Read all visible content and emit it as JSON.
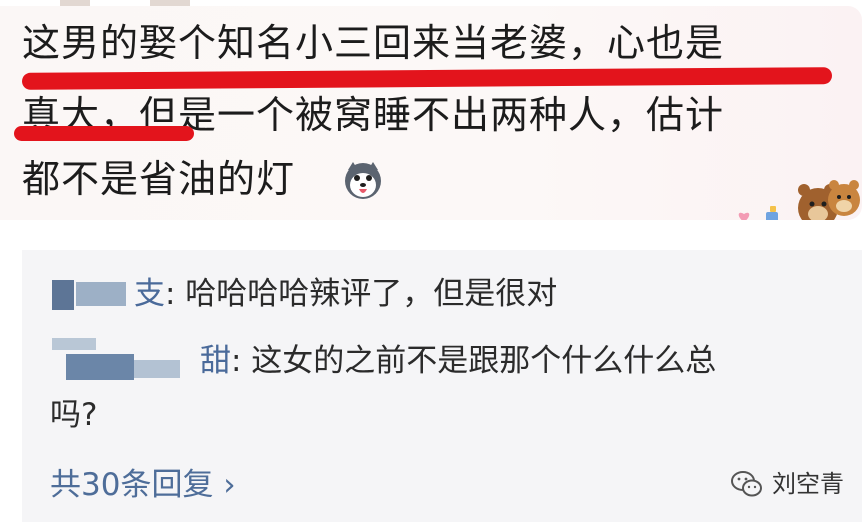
{
  "post": {
    "lines": [
      "这男的娶个知名小三回来当老婆，心也是",
      "真大，但是一个被窝睡不出两种人，估计",
      "都不是省油的灯"
    ],
    "emoji": "husky-emoji",
    "sticker": "bears-sticker"
  },
  "replies": [
    {
      "user_suffix": "支",
      "text": ": 哈哈哈哈辣评了，但是很对"
    },
    {
      "user_suffix": "甜",
      "text": ": 这女的之前不是跟那个什么什么总"
    }
  ],
  "reply_continuation": "吗?",
  "more_replies": "共30条回复 ›",
  "watermark": {
    "icon": "wechat-icon",
    "name": "刘空青"
  },
  "colors": {
    "underline": "#e3141c",
    "username": "#4a6a9a",
    "reply_bg": "#f5f5f7"
  }
}
